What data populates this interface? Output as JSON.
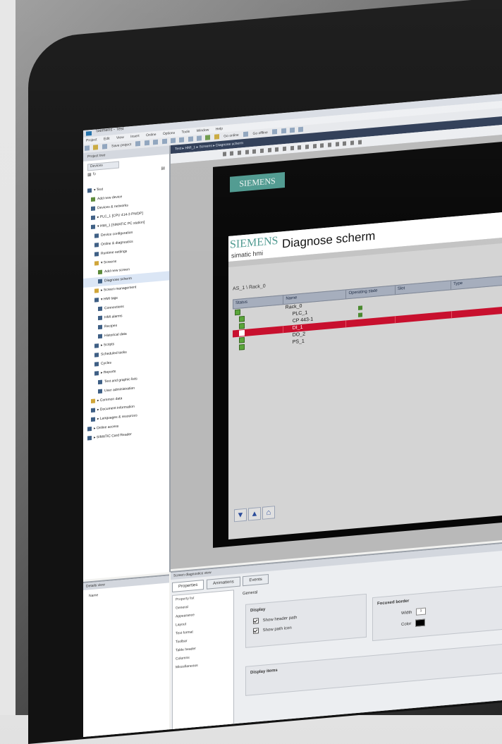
{
  "window": {
    "title": "Siemens - Test"
  },
  "menu": [
    "Project",
    "Edit",
    "View",
    "Insert",
    "Online",
    "Options",
    "Tools",
    "Window",
    "Help"
  ],
  "toolbar": {
    "save_label": "Save project",
    "go_online": "Go online",
    "go_offline": "Go offline"
  },
  "breadcrumb": "Test ▸ HMI_1 ▸ Screens ▸ Diagnose scherm",
  "tree": {
    "header": "Project tree",
    "tab": "Devices",
    "items": [
      {
        "label": "▾ Test",
        "icon": "project-icon"
      },
      {
        "label": "Add new device",
        "icon": "add-icon"
      },
      {
        "label": "Devices & networks",
        "icon": "network-icon"
      },
      {
        "label": "▸ PLC_1 [CPU 414-3 PN/DP]",
        "icon": "plc-icon"
      },
      {
        "label": "▾ HMI_1 [SIMATIC PC station]",
        "icon": "hmi-icon"
      },
      {
        "label": "Device configuration",
        "icon": "config-icon"
      },
      {
        "label": "Online & diagnostics",
        "icon": "diag-icon"
      },
      {
        "label": "Runtime settings",
        "icon": "settings-icon"
      },
      {
        "label": "▾ Screens",
        "icon": "folder-icon"
      },
      {
        "label": "Add new screen",
        "icon": "add-icon"
      },
      {
        "label": "Diagnose scherm",
        "icon": "screen-icon"
      },
      {
        "label": "▸ Screen management",
        "icon": "folder-icon"
      },
      {
        "label": "▾ HMI tags",
        "icon": "tags-icon"
      },
      {
        "label": "Connections",
        "icon": "connection-icon"
      },
      {
        "label": "HMI alarms",
        "icon": "alarm-icon"
      },
      {
        "label": "Recipes",
        "icon": "recipe-icon"
      },
      {
        "label": "Historical data",
        "icon": "data-icon"
      },
      {
        "label": "▸ Scripts",
        "icon": "script-icon"
      },
      {
        "label": "Scheduled tasks",
        "icon": "task-icon"
      },
      {
        "label": "Cycles",
        "icon": "cycle-icon"
      },
      {
        "label": "▸ Reports",
        "icon": "report-icon"
      },
      {
        "label": "Text and graphic lists",
        "icon": "list-icon"
      },
      {
        "label": "User administration",
        "icon": "user-icon"
      },
      {
        "label": "▸ Common data",
        "icon": "folder-icon"
      },
      {
        "label": "▸ Document information",
        "icon": "doc-icon"
      },
      {
        "label": "▸ Languages & resources",
        "icon": "lang-icon"
      },
      {
        "label": "▸ Online access",
        "icon": "online-icon"
      },
      {
        "label": "▸ SIMATIC Card Reader",
        "icon": "card-icon"
      }
    ]
  },
  "details": {
    "header": "Details view",
    "name_label": "Name"
  },
  "hmi": {
    "brand": "SIEMENS",
    "faceplate_brand": "SIEMENS",
    "faceplate_sub": "simatic hmi",
    "title": "Diagnose scherm",
    "path": "AS_1 \\ Rack_0",
    "columns": [
      "Status",
      "Name",
      "Operating state",
      "Slot",
      "Type"
    ],
    "rows": [
      {
        "name": "Rack_0",
        "status": "ok",
        "op": false,
        "error": false,
        "indent": 0
      },
      {
        "name": "PLC_1",
        "status": "ok",
        "op": true,
        "error": false,
        "indent": 1
      },
      {
        "name": "CP 443-1",
        "status": "ok",
        "op": true,
        "error": false,
        "indent": 1
      },
      {
        "name": "DI_1",
        "status": "error",
        "op": false,
        "error": true,
        "indent": 1
      },
      {
        "name": "DO_2",
        "status": "ok",
        "op": false,
        "error": false,
        "indent": 1
      },
      {
        "name": "PS_1",
        "status": "ok",
        "op": false,
        "error": false,
        "indent": 1
      }
    ]
  },
  "properties": {
    "header": "Screen diagnostics view",
    "tabs": [
      "Properties",
      "Animations",
      "Events"
    ],
    "list_header": "Property list",
    "list": [
      "General",
      "Appearance",
      "Layout",
      "Text format",
      "Toolbar",
      "Table header",
      "Columns",
      "Miscellaneous"
    ],
    "general_label": "General",
    "display_label": "Display",
    "cb1": "Show header path",
    "cb2": "Show path icon",
    "focused_border": "Focused border",
    "width_label": "Width",
    "width_value": "1",
    "color_label": "Color",
    "display_items": "Display items"
  },
  "colors": {
    "siemens_teal": "#4f9a90",
    "error_red": "#c8102e",
    "status_green": "#5aa63a"
  }
}
